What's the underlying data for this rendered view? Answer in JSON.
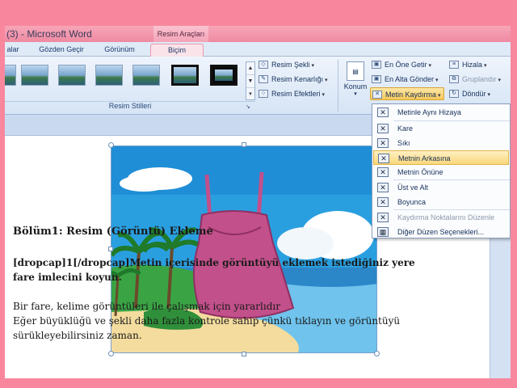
{
  "window": {
    "title": "(3) - Microsoft Word",
    "context_group": "Resim Araçları"
  },
  "tabs": [
    {
      "label": "alar"
    },
    {
      "label": "Gözden Geçir"
    },
    {
      "label": "Görünüm"
    },
    {
      "label": "Biçim",
      "active": true
    }
  ],
  "ribbon": {
    "picture_styles_group": "Resim Stilleri",
    "picture_shape": "Resim Şekli",
    "picture_border": "Resim Kenarlığı",
    "picture_effects": "Resim Efektleri",
    "position": "Konum",
    "bring_to_front": "En Öne Getir",
    "send_to_back": "En Alta Gönder",
    "text_wrapping": "Metin Kaydırma",
    "align": "Hizala",
    "group": "Gruplandır",
    "rotate": "Döndür"
  },
  "wrap_menu": {
    "items": [
      {
        "label": "Metinle Aynı Hizaya",
        "state": "normal"
      },
      {
        "label": "Kare",
        "state": "normal"
      },
      {
        "label": "Sıkı",
        "state": "normal"
      },
      {
        "label": "Metnin Arkasına",
        "state": "highlighted"
      },
      {
        "label": "Metnin Önüne",
        "state": "normal"
      },
      {
        "label": "Üst ve Alt",
        "state": "normal"
      },
      {
        "label": "Boyunca",
        "state": "normal"
      },
      {
        "label": "Kaydırma Noktalarını Düzenle",
        "state": "disabled"
      },
      {
        "label": "Diğer Düzen Seçenekleri...",
        "state": "normal"
      }
    ]
  },
  "document": {
    "heading": "Bölüm1: Resim (Görüntü) Ekleme",
    "para1_line1": "[dropcap]1[/dropcap]Metin içerisinde görüntüyü eklemek istediğiniz yere",
    "para1_line2": "fare imlecini koyun.",
    "para2_line1": "Bir fare, kelime görüntüleri ile çalışmak için yararlıdır",
    "para2_line2": "Eğer büyüklüğü ve şekli daha fazla kontrole sahip çünkü tıklayın ve görüntüyü",
    "para2_line3": "sürükleyebilirsiniz zaman."
  },
  "colors": {
    "background": "#f8879e",
    "menu_highlight": "#fad77a",
    "dress": "#c2508a"
  }
}
